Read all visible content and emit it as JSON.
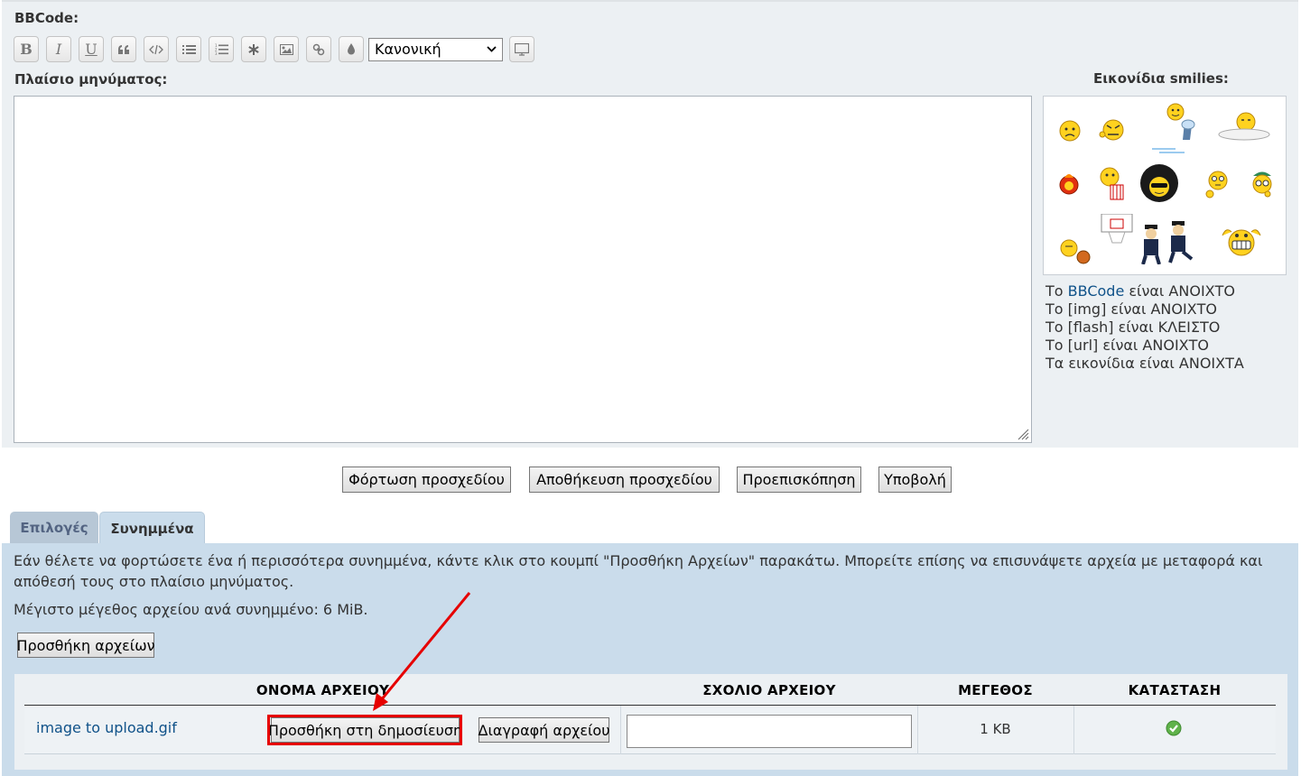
{
  "editor": {
    "bbcode_label": "BBCode:",
    "toolbar": [
      "bold-icon",
      "italic-icon",
      "underline-icon",
      "quote-icon",
      "code-icon",
      "list-icon",
      "ordered-list-icon",
      "asterisk-icon",
      "image-icon",
      "link-icon",
      "color-icon"
    ],
    "bold": "B",
    "italic": "I",
    "underline": "U",
    "font_size_value": "Κανονική",
    "message_label": "Πλαίσιο μηνύματος:",
    "smilies_label": "Εικονίδια smilies:",
    "status": {
      "line1_prefix": "Το ",
      "line1_link": "BBCode",
      "line1_suffix": " είναι ΑΝΟΙΧΤΟ",
      "line2": "Το [img] είναι ΑΝΟΙΧΤΟ",
      "line3": "Το [flash] είναι ΚΛΕΙΣΤΟ",
      "line4": "Το [url] είναι ΑΝΟΙΧΤΟ",
      "line5": "Τα εικονίδια είναι ΑΝΟΙΧΤΑ"
    }
  },
  "actions": {
    "load_draft": "Φόρτωση προσχεδίου",
    "save_draft": "Αποθήκευση προσχεδίου",
    "preview": "Προεπισκόπηση",
    "submit": "Υποβολή"
  },
  "tabs": {
    "options": "Επιλογές",
    "attachments": "Συνημμένα"
  },
  "attachments": {
    "instructions": "Εάν θέλετε να φορτώσετε ένα ή περισσότερα συνημμένα, κάντε κλικ στο κουμπί \"Προσθήκη Αρχείων\" παρακάτω. Μπορείτε επίσης να επισυνάψετε αρχεία με μεταφορά και απόθεσή τους στο πλαίσιο μηνύματος.",
    "max_size": "Μέγιστο μέγεθος αρχείου ανά συνημμένο: 6 MiB.",
    "add_files": "Προσθήκη αρχείων",
    "columns": {
      "filename": "ΟΝΟΜΑ ΑΡΧΕΙΟΥ",
      "comment": "ΣΧΟΛΙΟ ΑΡΧΕΙΟΥ",
      "size": "ΜΕΓΕΘΟΣ",
      "status": "ΚΑΤΑΣΤΑΣΗ"
    },
    "rows": [
      {
        "filename": "image to upload.gif",
        "place_inline": "Προσθήκη στη δημοσίευση",
        "delete": "Διαγραφή αρχείου",
        "comment": "",
        "size": "1 KB",
        "status_icon": "check-icon"
      }
    ]
  },
  "colors": {
    "link": "#105289",
    "panel_top": "#ecf0f3",
    "panel_attach": "#cadceb",
    "highlight": "#e60000"
  }
}
